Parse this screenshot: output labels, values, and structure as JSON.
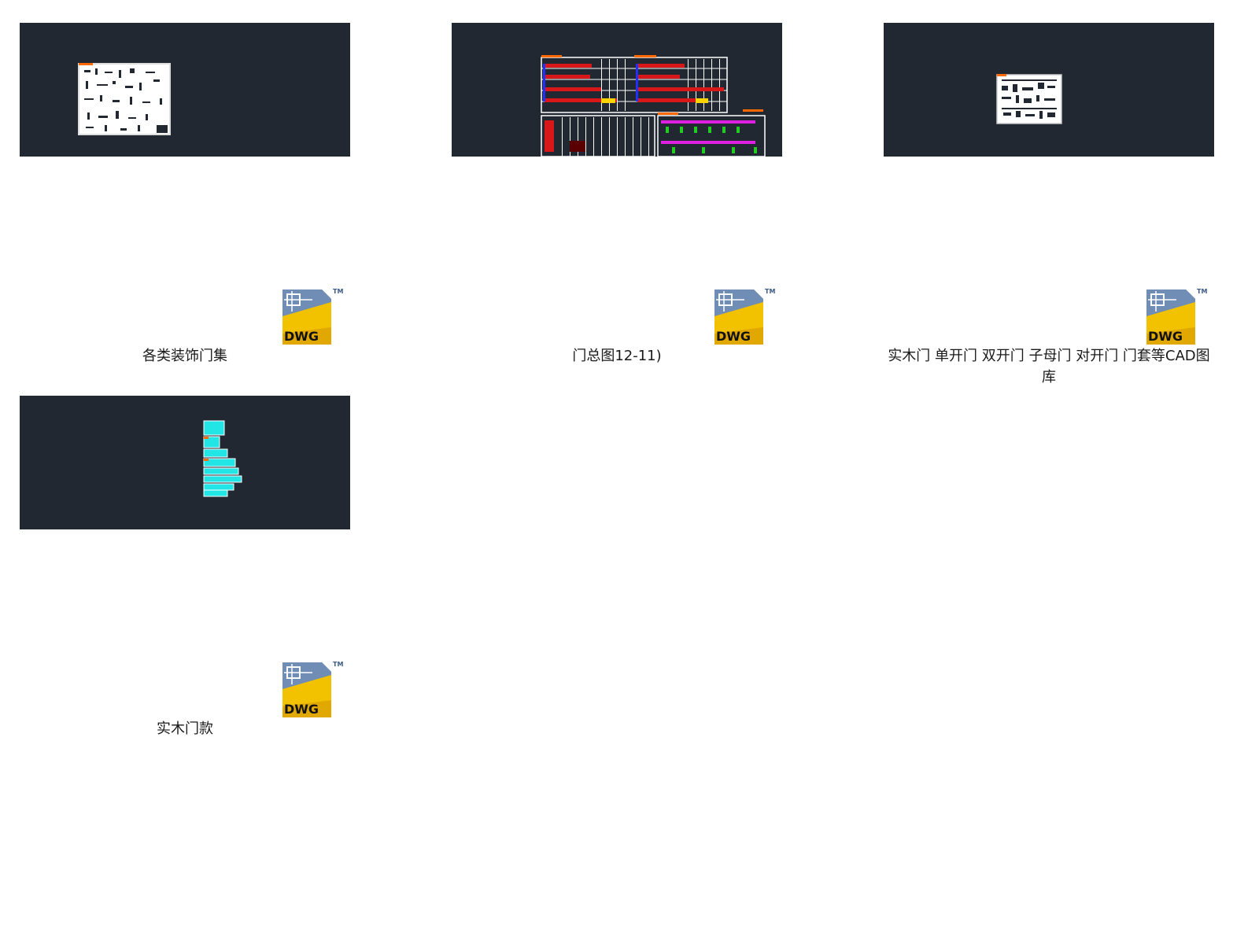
{
  "files": [
    {
      "name": "各类装饰门集",
      "type_badge": "DWG",
      "icon": "dwg-file-icon"
    },
    {
      "name": "门总图12-11)",
      "type_badge": "DWG",
      "icon": "dwg-file-icon"
    },
    {
      "name": "实木门  单开门 双开门 子母门 对开门 门套等CAD图库",
      "type_badge": "DWG",
      "icon": "dwg-file-icon"
    },
    {
      "name": "实木门款",
      "type_badge": "DWG",
      "icon": "dwg-file-icon"
    }
  ],
  "icon_trademark": "TM",
  "colors": {
    "thumbnail_bg": "#222831",
    "dwg_yellow": "#f2c200",
    "dwg_blue": "#3b5a86",
    "cad_orange": "#ff6a00",
    "cad_cyan": "#22e6e6"
  }
}
